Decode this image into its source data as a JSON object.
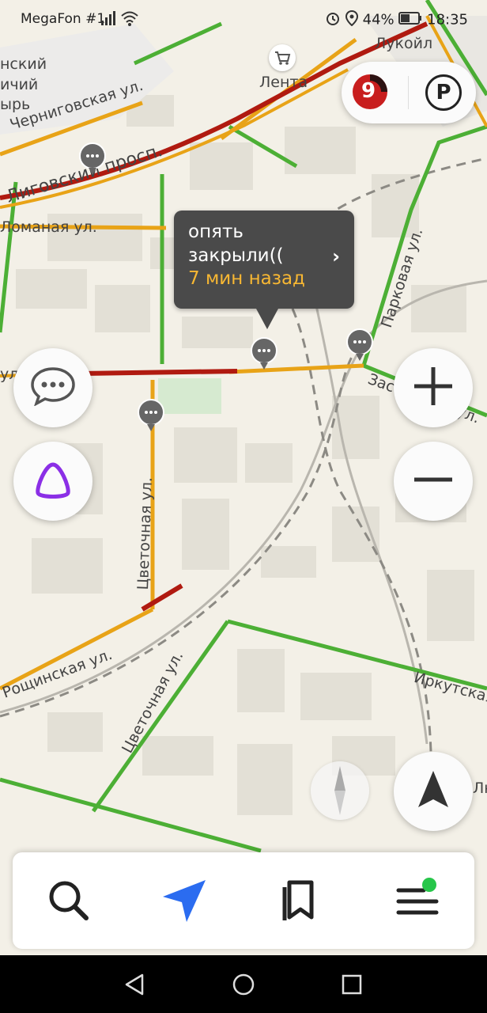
{
  "status_bar": {
    "carrier": "MegaFon #1",
    "battery": "44%",
    "time": "18:35"
  },
  "map": {
    "labels": {
      "lukoil": "Лукойл",
      "lenta": "Лента",
      "chernigovskaya": "Черниговская ул.",
      "ligovsky": "Лиговский просп.",
      "lomanaya": "Ломаная ул.",
      "parkovaya": "Парковая ул.",
      "zastavskaya": "Заставская ул.",
      "tsvetochnaya1": "Цветочная ул.",
      "tsvetochnaya2": "Цветочная ул.",
      "roshchinskaya": "Рощинская ул.",
      "irkutskaya": "Иркутская",
      "left_top_1": "нский",
      "left_top_2": "ичий",
      "left_top_3": "ырь",
      "edge_left": "ул",
      "edge_right": "Лн"
    }
  },
  "traffic": {
    "level": "9"
  },
  "parking": {
    "label": "P"
  },
  "popup": {
    "text": "опять закрыли((",
    "time": "7 мин назад",
    "arrow": "›"
  },
  "colors": {
    "traffic_green": "#4caf35",
    "traffic_yellow": "#e8a317",
    "traffic_red": "#b01a10",
    "popup_time": "#f7b733",
    "alice_purple": "#8b2fe6",
    "nav_blue": "#2b6cf0",
    "notification_dot": "#27c64a"
  },
  "icons": {
    "tabs": [
      "search-icon",
      "navigation-arrow-icon",
      "bookmarks-icon",
      "menu-icon"
    ]
  }
}
